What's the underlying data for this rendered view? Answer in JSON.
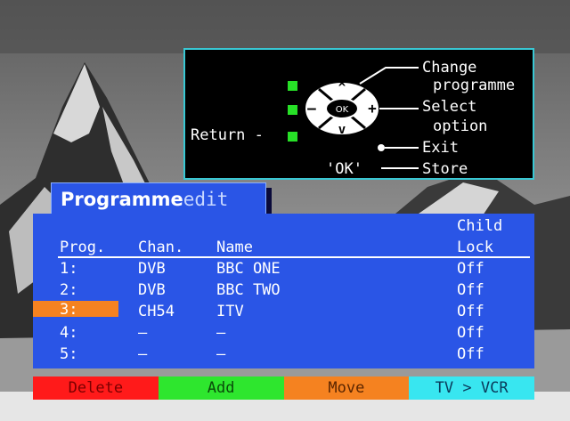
{
  "help": {
    "change": "Change",
    "programme": "programme",
    "select": "Select",
    "option": "option",
    "exit": "Exit",
    "return_label": "Return -",
    "ok_key": "'OK'",
    "store": "Store",
    "ok_button": "OK"
  },
  "title": {
    "main": "Programme",
    "ghost": "edit"
  },
  "table": {
    "child_lock_top": "Child",
    "headers": {
      "prog": "Prog.",
      "chan": "Chan.",
      "name": "Name",
      "lock": "Lock"
    },
    "rows": [
      {
        "prog": "1:",
        "chan": "DVB",
        "name": "BBC ONE",
        "lock": "Off"
      },
      {
        "prog": "2:",
        "chan": "DVB",
        "name": "BBC TWO",
        "lock": "Off"
      },
      {
        "prog": "3:",
        "chan": "CH54",
        "name": "ITV",
        "lock": "Off"
      },
      {
        "prog": "4:",
        "chan": "–",
        "name": "–",
        "lock": "Off"
      },
      {
        "prog": "5:",
        "chan": "–",
        "name": "–",
        "lock": "Off"
      }
    ],
    "selected_row": 3
  },
  "keys": {
    "delete": "Delete",
    "add": "Add",
    "move": "Move",
    "tv_vcr": "TV > VCR"
  },
  "colors": {
    "panel_blue": "#2a55e6",
    "highlight_orange": "#f58220",
    "help_border": "#39c8d4",
    "indicator_green": "#27e027"
  }
}
